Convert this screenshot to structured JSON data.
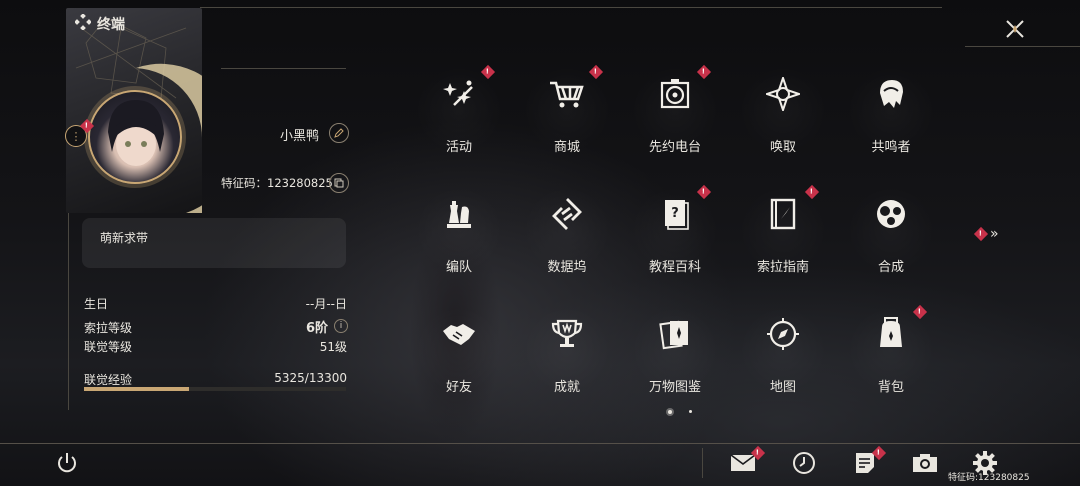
{
  "header": {
    "title": "终端"
  },
  "profile": {
    "username": "小黑鸭",
    "uid_label": "特征码：",
    "uid": "123280825",
    "signature": "萌新求带"
  },
  "stats": {
    "birthday_label": "生日",
    "birthday_value": "--月--日",
    "sola_level_label": "索拉等级",
    "sola_level_value": "6阶",
    "union_level_label": "联觉等级",
    "union_level_value": "51级",
    "union_exp_label": "联觉经验",
    "union_exp_value": "5325/13300",
    "union_exp_fraction": 0.4
  },
  "menu": [
    {
      "label": "活动",
      "icon": "event-sparkle-icon",
      "badge": true
    },
    {
      "label": "商城",
      "icon": "shop-cart-icon",
      "badge": true
    },
    {
      "label": "先约电台",
      "icon": "radio-record-icon",
      "badge": true
    },
    {
      "label": "唤取",
      "icon": "summon-star-icon",
      "badge": false
    },
    {
      "label": "共鸣者",
      "icon": "resonator-head-icon",
      "badge": false
    },
    {
      "label": "编队",
      "icon": "team-chess-icon",
      "badge": false
    },
    {
      "label": "数据坞",
      "icon": "data-dock-icon",
      "badge": false
    },
    {
      "label": "教程百科",
      "icon": "tutorial-book-icon",
      "badge": true
    },
    {
      "label": "索拉指南",
      "icon": "guide-book-icon",
      "badge": true
    },
    {
      "label": "合成",
      "icon": "synthesis-icon",
      "badge": false
    },
    {
      "label": "好友",
      "icon": "handshake-icon",
      "badge": false
    },
    {
      "label": "成就",
      "icon": "trophy-icon",
      "badge": false
    },
    {
      "label": "万物图鉴",
      "icon": "cards-icon",
      "badge": false
    },
    {
      "label": "地图",
      "icon": "compass-icon",
      "badge": false
    },
    {
      "label": "背包",
      "icon": "backpack-icon",
      "badge": true
    }
  ],
  "footer": {
    "uid_label": "特征码:",
    "uid": "123280825"
  },
  "badge_mark": "!",
  "colors": {
    "accent": "#c9a774",
    "badge": "#c8324a"
  }
}
